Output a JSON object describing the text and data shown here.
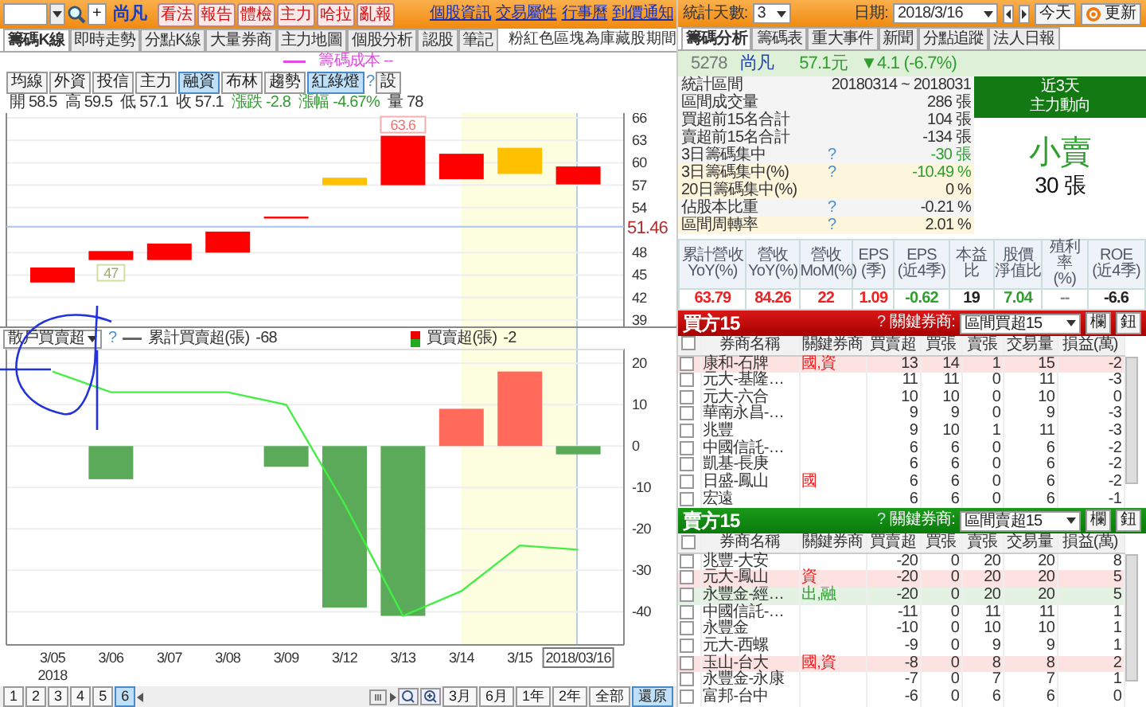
{
  "left": {
    "add": "+",
    "title": "尚凡",
    "action_buttons": [
      "看法",
      "報告",
      "體檢",
      "主力",
      "哈拉",
      "亂報"
    ],
    "links": [
      "個股資訊",
      "交易屬性",
      "行事曆",
      "到價通知"
    ],
    "tabs": [
      {
        "label": "籌碼K線",
        "selected": true
      },
      {
        "label": "即時走勢",
        "selected": false
      },
      {
        "label": "分點K線",
        "selected": false
      },
      {
        "label": "大量券商",
        "selected": false
      },
      {
        "label": "主力地圖",
        "selected": false
      },
      {
        "label": "個股分析",
        "selected": false
      },
      {
        "label": "認股",
        "selected": false
      },
      {
        "label": "筆記",
        "selected": false
      }
    ],
    "note": "粉紅色區塊為庫藏股期間",
    "cost_legend": "籌碼成本 --",
    "tools": [
      {
        "label": "均線",
        "selected": false
      },
      {
        "label": "外資",
        "selected": false
      },
      {
        "label": "投信",
        "selected": false
      },
      {
        "label": "主力",
        "selected": false
      },
      {
        "label": "融資",
        "selected": true
      },
      {
        "label": "布林",
        "selected": false
      },
      {
        "label": "趨勢",
        "selected": false
      },
      {
        "label": "紅綠燈",
        "selected": true
      }
    ],
    "tools_help": "?",
    "settings": "設",
    "ohlc": [
      {
        "label": "開",
        "value": "58.5",
        "color": "#333333"
      },
      {
        "label": "高",
        "value": "59.5",
        "color": "#333333"
      },
      {
        "label": "低",
        "value": "57.1",
        "color": "#333333"
      },
      {
        "label": "收",
        "value": "57.1",
        "color": "#333333"
      },
      {
        "label": "漲跌",
        "value": "-2.8",
        "color": "#2e9e2e"
      },
      {
        "label": "漲幅",
        "value": "-4.67%",
        "color": "#2e9e2e"
      },
      {
        "label": "量",
        "value": "78",
        "color": "#333333"
      }
    ],
    "price_chart": {
      "y_labels": [
        "66",
        "63",
        "60",
        "57",
        "54",
        "48",
        "45",
        "42",
        "39"
      ],
      "callouts": [
        "63.6",
        "47"
      ],
      "cost_label": "51.46"
    },
    "flow": {
      "dropdown": "散戶買賣超",
      "help": "?",
      "legend_values": [
        "-68",
        "-2"
      ],
      "year_label": "2018",
      "chart_data": {
        "type": "bar",
        "categories": [
          "3/05",
          "3/06",
          "3/07",
          "3/08",
          "3/09",
          "3/12",
          "3/13",
          "3/14",
          "3/15",
          "2018/03/16"
        ],
        "series": [
          {
            "name": "累計買賣超(張)",
            "type": "line",
            "color": "#44ee44",
            "values": [
              18,
              13,
              13,
              13,
              10,
              -14,
              -41,
              -35,
              -24,
              -25
            ]
          },
          {
            "name": "買賣超(張)",
            "color": "#5aaa5a",
            "values": [
              null,
              -8,
              null,
              null,
              -5,
              -39,
              -41,
              null,
              null,
              -2
            ]
          },
          {
            "color": "#ff6a5a",
            "values": [
              null,
              null,
              null,
              null,
              null,
              null,
              null,
              9,
              18,
              null
            ]
          }
        ],
        "stacked": true,
        "grid": true,
        "ylim": [
          -48,
          23.5
        ],
        "yticks": [
          -40,
          -30,
          -20,
          -10,
          0,
          10,
          20
        ]
      }
    },
    "pages": [
      {
        "label": "1",
        "selected": false
      },
      {
        "label": "2",
        "selected": false
      },
      {
        "label": "3",
        "selected": false
      },
      {
        "label": "4",
        "selected": false
      },
      {
        "label": "5",
        "selected": false
      },
      {
        "label": "6",
        "selected": true
      }
    ],
    "ranges": [
      {
        "label": "3月",
        "selected": false
      },
      {
        "label": "6月",
        "selected": false
      },
      {
        "label": "1年",
        "selected": false
      },
      {
        "label": "2年",
        "selected": false
      },
      {
        "label": "全部",
        "selected": false
      },
      {
        "label": "還原",
        "selected": true
      }
    ]
  },
  "right": {
    "days_label": "統計天數:",
    "days": "3",
    "date_label": "日期:",
    "date": "2018/3/16",
    "today": "今天",
    "refresh": "更新",
    "tabs": [
      {
        "label": "籌碼分析",
        "selected": true
      },
      {
        "label": "籌碼表",
        "selected": false
      },
      {
        "label": "重大事件",
        "selected": false
      },
      {
        "label": "新聞",
        "selected": false
      },
      {
        "label": "分點追蹤",
        "selected": false
      },
      {
        "label": "法人日報",
        "selected": false
      }
    ],
    "quote": {
      "code": "5278",
      "name": "尚凡",
      "price": "57.1元",
      "change": "▼4.1 (-6.7%)"
    },
    "stats": [
      {
        "label": "統計區間",
        "value": "20180314 ~ 2018031",
        "color": "#333333",
        "highlighted": false
      },
      {
        "label": "區間成交量",
        "value": "286 張",
        "color": "#333333",
        "highlighted": false
      },
      {
        "label": "買超前15名合計",
        "value": "104 張",
        "color": "#333333",
        "highlighted": false
      },
      {
        "label": "賣超前15名合計",
        "value": "-134 張",
        "color": "#333333",
        "highlighted": false
      },
      {
        "label": "3日籌碼集中",
        "help": "?",
        "value": "-30 張",
        "color": "#2e9e2e",
        "highlighted": false
      },
      {
        "label": "3日籌碼集中(%)",
        "help": "?",
        "value": "-10.49 %",
        "color": "#2e9e2e",
        "highlighted": true
      },
      {
        "label": "20日籌碼集中(%)",
        "value": "0 %",
        "color": "#333333",
        "highlighted": true
      },
      {
        "label": "佔股本比重",
        "help": "?",
        "value": "-0.21 %",
        "color": "#333333",
        "highlighted": false
      },
      {
        "label": "區間周轉率",
        "help": "?",
        "value": "2.01 %",
        "color": "#333333",
        "highlighted": true
      }
    ],
    "trend": {
      "title": "近3天",
      "subtitle": "主力動向",
      "action": "小賣",
      "amount": "30 張"
    },
    "fundamentals": [
      {
        "header": [
          "累計營收",
          "YoY(%)"
        ],
        "value": "63.79",
        "color": "#ee2222"
      },
      {
        "header": [
          "營收",
          "YoY(%)"
        ],
        "value": "84.26",
        "color": "#ee2222"
      },
      {
        "header": [
          "營收",
          "MoM(%)"
        ],
        "value": "22",
        "color": "#ee2222"
      },
      {
        "header": [
          "EPS",
          "(季)"
        ],
        "value": "1.09",
        "color": "#ee2222"
      },
      {
        "header": [
          "EPS",
          "(近4季)"
        ],
        "value": "-0.62",
        "color": "#2e9e2e"
      },
      {
        "header": [
          "本益比"
        ],
        "value": "19",
        "color": "#222222"
      },
      {
        "header": [
          "股價",
          "淨值比"
        ],
        "value": "7.04",
        "color": "#2e9e2e"
      },
      {
        "header": [
          "殖利率",
          "(%)"
        ],
        "value": "--",
        "color": "#888888"
      },
      {
        "header": [
          "ROE",
          "(近4季)"
        ],
        "value": "-6.6",
        "color": "#222222"
      }
    ],
    "tables": [
      {
        "kind": "buy",
        "title": "買方15",
        "help": "?",
        "key_label": "關鍵券商:",
        "select": "區間買超15",
        "buttons": [
          "欄",
          "鈕"
        ],
        "all_checked": false,
        "columns": [
          "券商名稱",
          "關鍵券商",
          "買賣超",
          "買張",
          "賣張",
          "交易量",
          "損益(萬)"
        ],
        "rows": [
          {
            "checked": false,
            "highlighted": true,
            "color": "#ee2222",
            "cells": [
              "康和-石牌",
              "國,資",
              "13",
              "14",
              "1",
              "15",
              "-2"
            ]
          },
          {
            "checked": false,
            "highlighted": false,
            "cells": [
              "元大-基隆…",
              "",
              "11",
              "11",
              "0",
              "11",
              "-3"
            ]
          },
          {
            "checked": false,
            "highlighted": false,
            "cells": [
              "元大-六合",
              "",
              "10",
              "10",
              "0",
              "10",
              "0"
            ]
          },
          {
            "checked": false,
            "highlighted": false,
            "cells": [
              "華南永昌-…",
              "",
              "9",
              "9",
              "0",
              "9",
              "-3"
            ]
          },
          {
            "checked": false,
            "highlighted": false,
            "cells": [
              "兆豐",
              "",
              "9",
              "10",
              "1",
              "11",
              "-3"
            ]
          },
          {
            "checked": false,
            "highlighted": false,
            "cells": [
              "中國信託-…",
              "",
              "6",
              "6",
              "0",
              "6",
              "-2"
            ]
          },
          {
            "checked": false,
            "highlighted": false,
            "cells": [
              "凱基-長庚",
              "",
              "6",
              "6",
              "0",
              "6",
              "-2"
            ]
          },
          {
            "checked": false,
            "highlighted": false,
            "color": "#ee2222",
            "cells": [
              "日盛-鳳山",
              "國",
              "6",
              "6",
              "0",
              "6",
              "-2"
            ]
          },
          {
            "checked": false,
            "highlighted": false,
            "cells": [
              "宏遠",
              "",
              "6",
              "6",
              "0",
              "6",
              "-1"
            ]
          }
        ]
      },
      {
        "kind": "sell",
        "title": "賣方15",
        "help": "?",
        "key_label": "關鍵券商:",
        "select": "區間賣超15",
        "buttons": [
          "欄",
          "鈕"
        ],
        "all_checked": false,
        "columns": [
          "券商名稱",
          "關鍵券商",
          "買賣超",
          "買張",
          "賣張",
          "交易量",
          "損益(萬)"
        ],
        "rows": [
          {
            "checked": false,
            "highlighted": false,
            "cells": [
              "兆豐-大安",
              "",
              "-20",
              "0",
              "20",
              "20",
              "8"
            ]
          },
          {
            "checked": false,
            "highlighted": true,
            "color": "#ee2222",
            "cells": [
              "元大-鳳山",
              "資",
              "-20",
              "0",
              "20",
              "20",
              "5"
            ]
          },
          {
            "checked": false,
            "highlighted": true,
            "color": "#2e9e2e",
            "cells": [
              "永豐金-經…",
              "出,融",
              "-20",
              "0",
              "20",
              "20",
              "5"
            ]
          },
          {
            "checked": false,
            "highlighted": false,
            "cells": [
              "中國信託-…",
              "",
              "-11",
              "0",
              "11",
              "11",
              "1"
            ]
          },
          {
            "checked": false,
            "highlighted": false,
            "cells": [
              "永豐金",
              "",
              "-10",
              "0",
              "10",
              "10",
              "1"
            ]
          },
          {
            "checked": false,
            "highlighted": false,
            "cells": [
              "元大-西螺",
              "",
              "-9",
              "0",
              "9",
              "9",
              "1"
            ]
          },
          {
            "checked": false,
            "highlighted": true,
            "color": "#ee2222",
            "cells": [
              "玉山-台大",
              "國,資",
              "-8",
              "0",
              "8",
              "8",
              "2"
            ]
          },
          {
            "checked": false,
            "highlighted": false,
            "cells": [
              "永豐金-永康",
              "",
              "-7",
              "0",
              "7",
              "7",
              "1"
            ]
          },
          {
            "checked": false,
            "highlighted": false,
            "cells": [
              "富邦-台中",
              "",
              "-6",
              "0",
              "6",
              "6",
              "0"
            ]
          }
        ]
      }
    ]
  }
}
